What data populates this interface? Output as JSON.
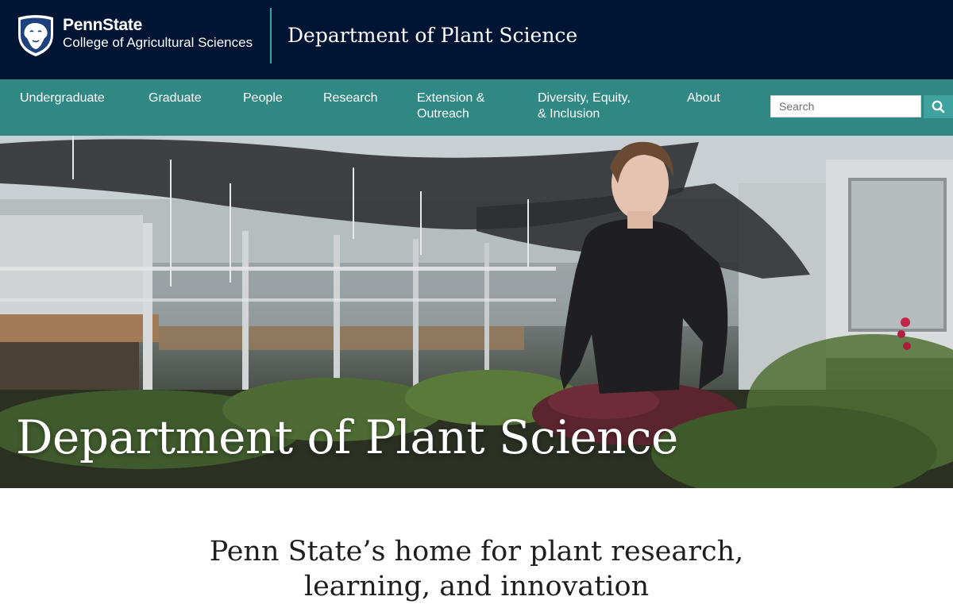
{
  "header": {
    "brand_name": "PennState",
    "college_name": "College of Agricultural Sciences",
    "department_name": "Department of Plant Science"
  },
  "nav": {
    "items": [
      {
        "label": "Undergraduate"
      },
      {
        "label": "Graduate"
      },
      {
        "label": "People"
      },
      {
        "label": "Research"
      },
      {
        "label": "Extension &\nOutreach"
      },
      {
        "label": "Diversity, Equity,\n& Inclusion"
      },
      {
        "label": "About"
      }
    ],
    "search": {
      "placeholder": "Search",
      "button_icon": "search-icon"
    }
  },
  "hero": {
    "title": "Department of Plant Science"
  },
  "intro": {
    "headline": "Penn State’s home for plant research, learning, and innovation"
  },
  "colors": {
    "header_bg": "#001534",
    "nav_bg": "#2f8883",
    "accent": "#3ea39e"
  }
}
